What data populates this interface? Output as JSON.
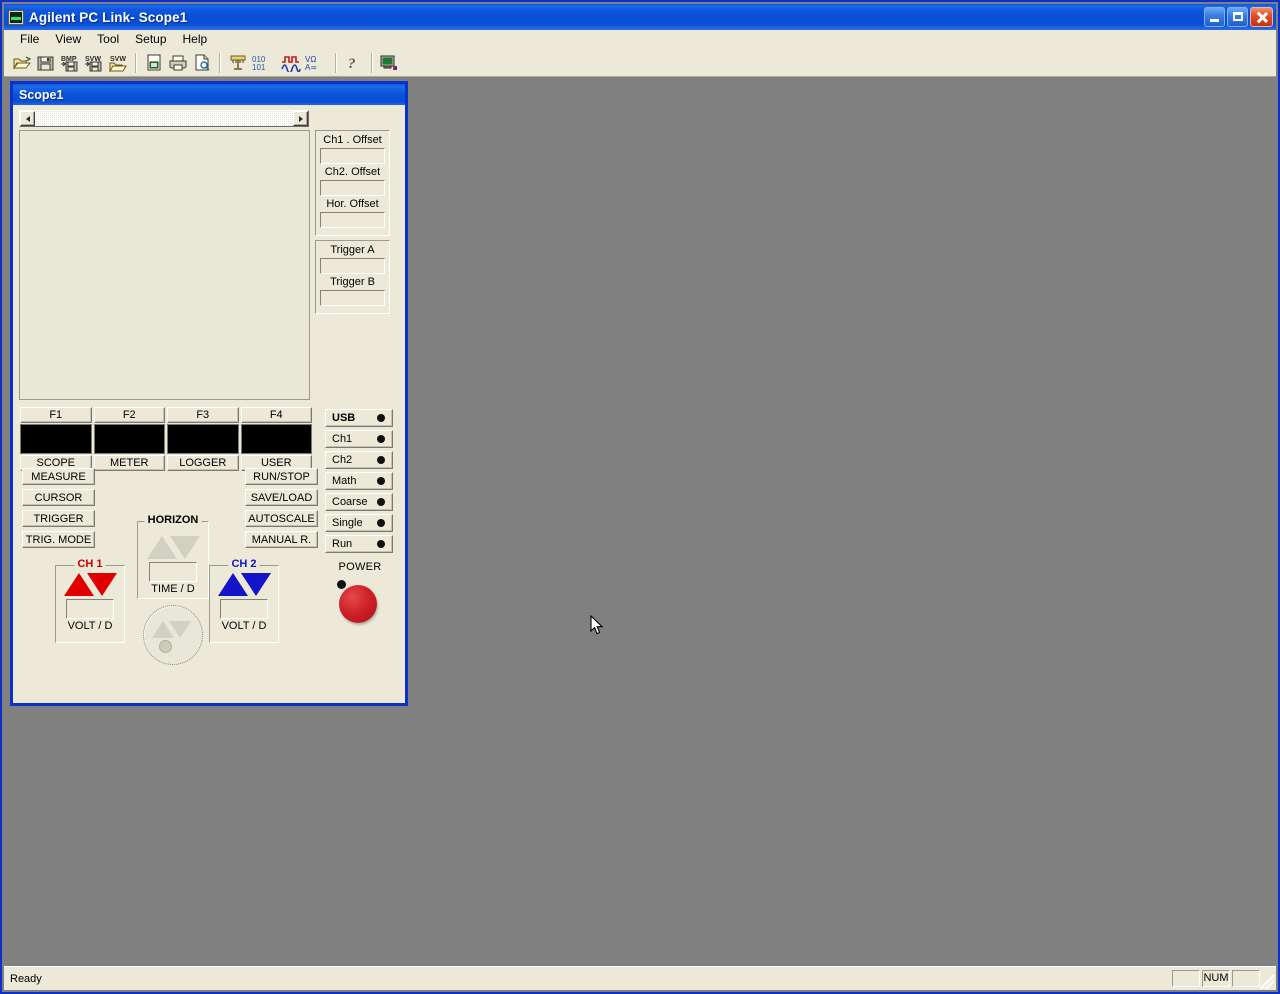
{
  "window": {
    "title": "Agilent PC Link- Scope1",
    "icon": "app-scope-icon",
    "buttons": {
      "minimize": "minimize",
      "maximize": "restore",
      "close": "close"
    }
  },
  "menubar": {
    "items": [
      {
        "label": "File"
      },
      {
        "label": "View"
      },
      {
        "label": "Tool"
      },
      {
        "label": "Setup"
      },
      {
        "label": "Help"
      }
    ]
  },
  "toolbar": {
    "groups": [
      {
        "buttons": [
          {
            "name": "open-icon",
            "title": "Open"
          },
          {
            "name": "save-icon",
            "title": "Save"
          },
          {
            "name": "save-bmp-icon",
            "title": "Save BMP"
          },
          {
            "name": "save-svw-icon",
            "title": "Save SVW"
          },
          {
            "name": "open-svw-icon",
            "title": "Open SVW"
          }
        ]
      },
      {
        "buttons": [
          {
            "name": "page-setup-icon",
            "title": "Page Setup"
          },
          {
            "name": "print-icon",
            "title": "Print"
          },
          {
            "name": "print-preview-icon",
            "title": "Print Preview"
          }
        ]
      },
      {
        "buttons": [
          {
            "name": "logger-icon",
            "title": "Logger"
          },
          {
            "name": "data-010-101-icon",
            "title": "Data"
          },
          {
            "name": "waveform-icon",
            "title": "Scope"
          },
          {
            "name": "meter-vohm-icon",
            "title": "Meter"
          }
        ]
      },
      {
        "buttons": [
          {
            "name": "help-icon",
            "title": "Help"
          }
        ]
      },
      {
        "buttons": [
          {
            "name": "connect-icon",
            "title": "Connect"
          }
        ]
      }
    ]
  },
  "scope_window": {
    "title": "Scope1",
    "scrollbar": {
      "left_arrow": "scroll-left",
      "right_arrow": "scroll-right"
    },
    "display": {
      "content": ""
    },
    "offsets": {
      "fields": [
        {
          "label": "Ch1 . Offset",
          "value": ""
        },
        {
          "label": "Ch2. Offset",
          "value": ""
        },
        {
          "label": "Hor. Offset",
          "value": ""
        }
      ]
    },
    "triggers": {
      "fields": [
        {
          "label": "Trigger A",
          "value": ""
        },
        {
          "label": "Trigger B",
          "value": ""
        }
      ]
    },
    "function_keys": [
      {
        "fkey": "F1",
        "screen": "",
        "mode": "SCOPE"
      },
      {
        "fkey": "F2",
        "screen": "",
        "mode": "METER"
      },
      {
        "fkey": "F3",
        "screen": "",
        "mode": "LOGGER"
      },
      {
        "fkey": "F4",
        "screen": "",
        "mode": "USER"
      }
    ],
    "left_buttons": [
      {
        "label": "MEASURE"
      },
      {
        "label": "CURSOR"
      },
      {
        "label": "TRIGGER"
      },
      {
        "label": "TRIG. MODE"
      }
    ],
    "right_buttons": [
      {
        "label": "RUN/STOP"
      },
      {
        "label": "SAVE/LOAD"
      },
      {
        "label": "AUTOSCALE"
      },
      {
        "label": "MANUAL R."
      }
    ],
    "indicators": [
      {
        "label": "USB",
        "bold": true,
        "led": "off"
      },
      {
        "label": "Ch1",
        "bold": false,
        "led": "off"
      },
      {
        "label": "Ch2",
        "bold": false,
        "led": "off"
      },
      {
        "label": "Math",
        "bold": false,
        "led": "off"
      },
      {
        "label": "Coarse",
        "bold": false,
        "led": "off"
      },
      {
        "label": "Single",
        "bold": false,
        "led": "off"
      },
      {
        "label": "Run",
        "bold": false,
        "led": "off"
      }
    ],
    "horizon": {
      "title": "HORIZON",
      "value": "",
      "unit_label": "TIME / D",
      "knob": "horizon-knob"
    },
    "ch1": {
      "title": "CH 1",
      "color": "#cc0000",
      "triangle_color": "#e00000",
      "value": "",
      "unit_label": "VOLT / D"
    },
    "ch2": {
      "title": "CH 2",
      "color": "#1414c8",
      "triangle_color": "#1414c8",
      "value": "",
      "unit_label": "VOLT / D"
    },
    "power": {
      "label": "POWER",
      "led": "off",
      "button_color": "#cf1f28"
    }
  },
  "statusbar": {
    "message": "Ready",
    "panes": [
      {
        "label": ""
      },
      {
        "label": "NUM"
      },
      {
        "label": ""
      }
    ]
  },
  "colors": {
    "desktop": "#808080",
    "face": "#ece9d8",
    "titlebar_blue": "#0b31c9",
    "display_bg": "#e9e7d7",
    "fkey_screen": "#000000"
  }
}
